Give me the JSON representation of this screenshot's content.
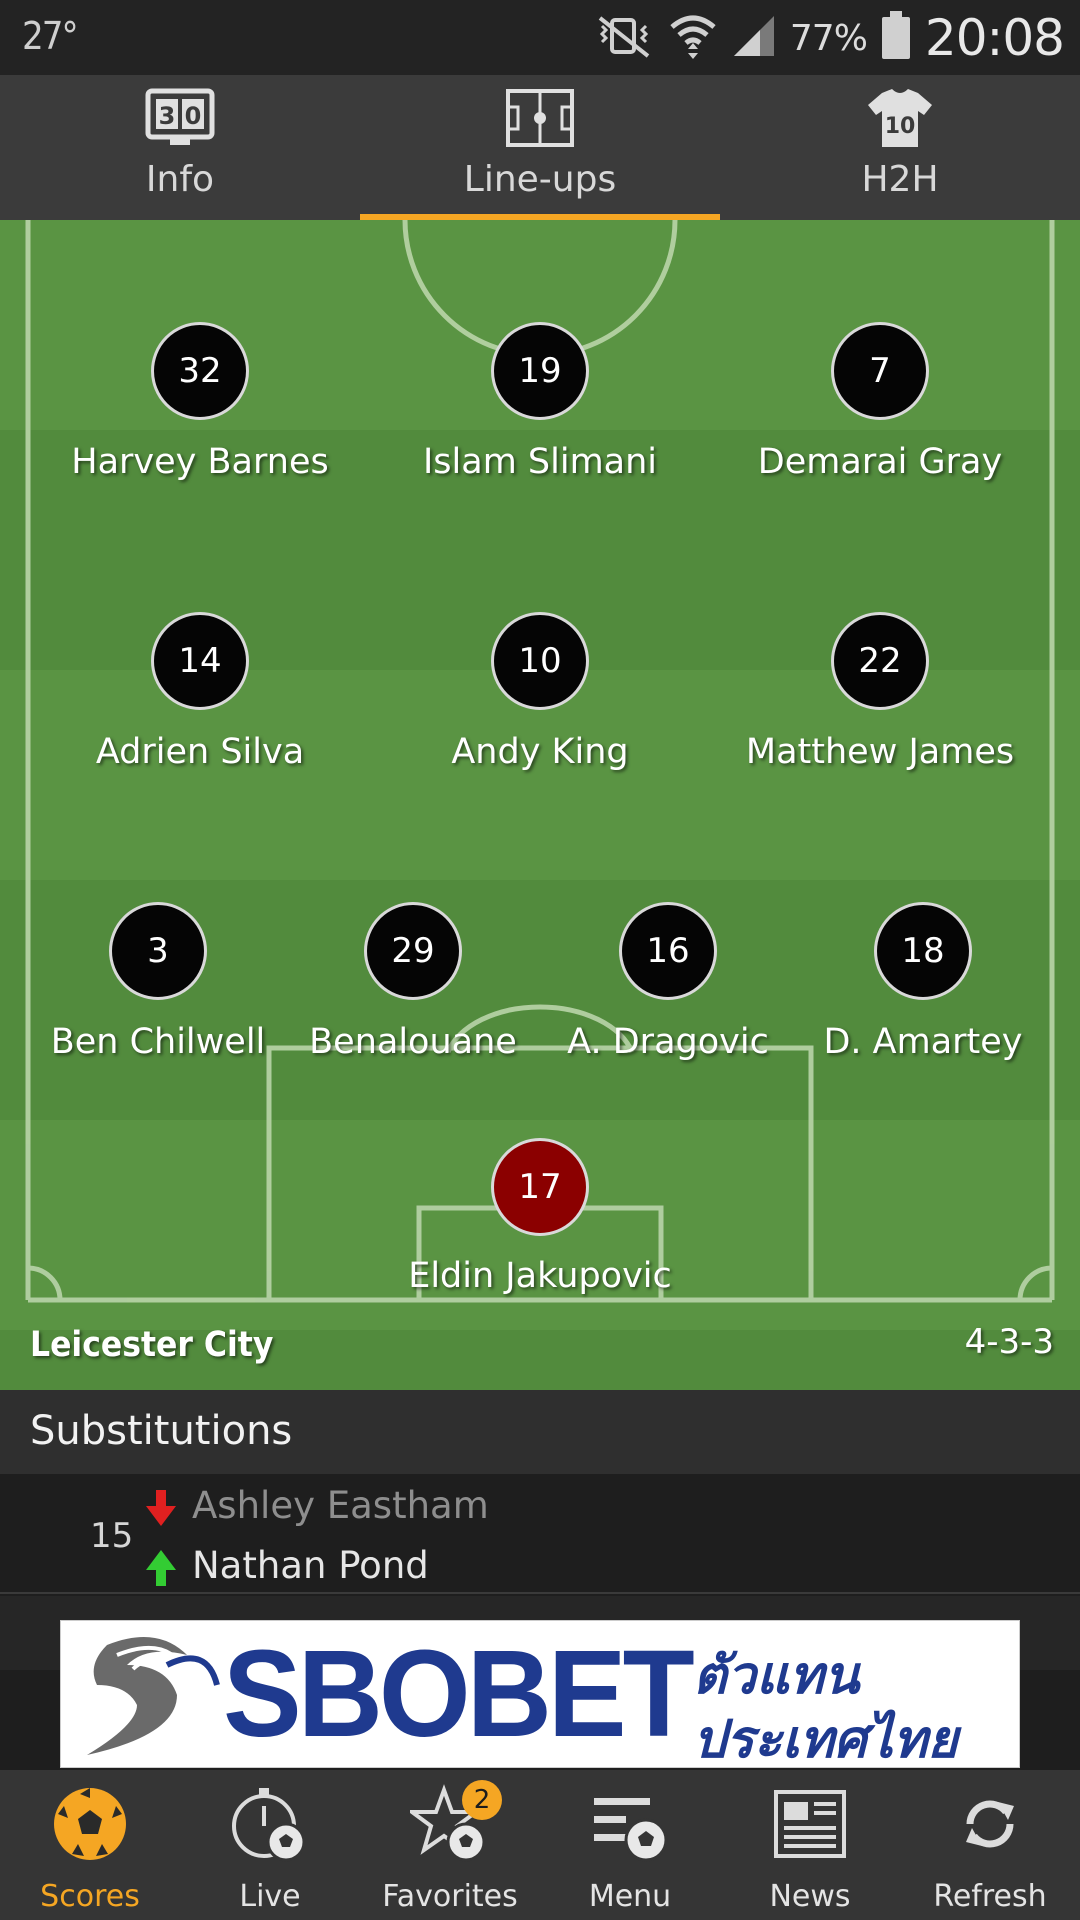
{
  "status_bar": {
    "temperature": "27°",
    "battery_percent": "77%",
    "time": "20:08"
  },
  "tabs": [
    {
      "label": "Info",
      "icon": "scoreboard-icon",
      "active": false
    },
    {
      "label": "Line-ups",
      "icon": "pitch-icon",
      "active": true
    },
    {
      "label": "H2H",
      "icon": "jersey-icon",
      "active": false
    }
  ],
  "lineup": {
    "team_name": "Leicester City",
    "formation": "4-3-3",
    "forwards": [
      {
        "number": "32",
        "name": "Harvey Barnes"
      },
      {
        "number": "19",
        "name": "Islam Slimani"
      },
      {
        "number": "7",
        "name": "Demarai Gray"
      }
    ],
    "midfielders": [
      {
        "number": "14",
        "name": "Adrien Silva"
      },
      {
        "number": "10",
        "name": "Andy King"
      },
      {
        "number": "22",
        "name": "Matthew James"
      }
    ],
    "defenders": [
      {
        "number": "3",
        "name": "Ben Chilwell"
      },
      {
        "number": "29",
        "name": "Benalouane"
      },
      {
        "number": "16",
        "name": "A. Dragovic"
      },
      {
        "number": "18",
        "name": "D. Amartey"
      }
    ],
    "goalkeeper": {
      "number": "17",
      "name": "Eldin Jakupovic"
    }
  },
  "substitutions": {
    "title": "Substitutions",
    "items": [
      {
        "minute": "15",
        "player_out": "Ashley Eastham",
        "player_in": "Nathan Pond"
      }
    ]
  },
  "ad": {
    "brand": "SBOBET",
    "thai_line1": "ตัวแทน",
    "thai_line2": "ประเทศไทย"
  },
  "bottom_nav": [
    {
      "label": "Scores",
      "icon": "soccer-ball-icon",
      "active": true
    },
    {
      "label": "Live",
      "icon": "stopwatch-ball-icon",
      "active": false
    },
    {
      "label": "Favorites",
      "icon": "star-ball-icon",
      "active": false,
      "badge": "2"
    },
    {
      "label": "Menu",
      "icon": "menu-ball-icon",
      "active": false
    },
    {
      "label": "News",
      "icon": "newspaper-icon",
      "active": false
    },
    {
      "label": "Refresh",
      "icon": "refresh-icon",
      "active": false
    }
  ],
  "colors": {
    "accent": "#f5a623",
    "pitch_light": "#5a9443",
    "pitch_dark": "#528b3d",
    "goalkeeper": "#8b0000",
    "sub_out": "#e02020",
    "sub_in": "#33cc33",
    "ad_brand": "#1f3a8f"
  }
}
